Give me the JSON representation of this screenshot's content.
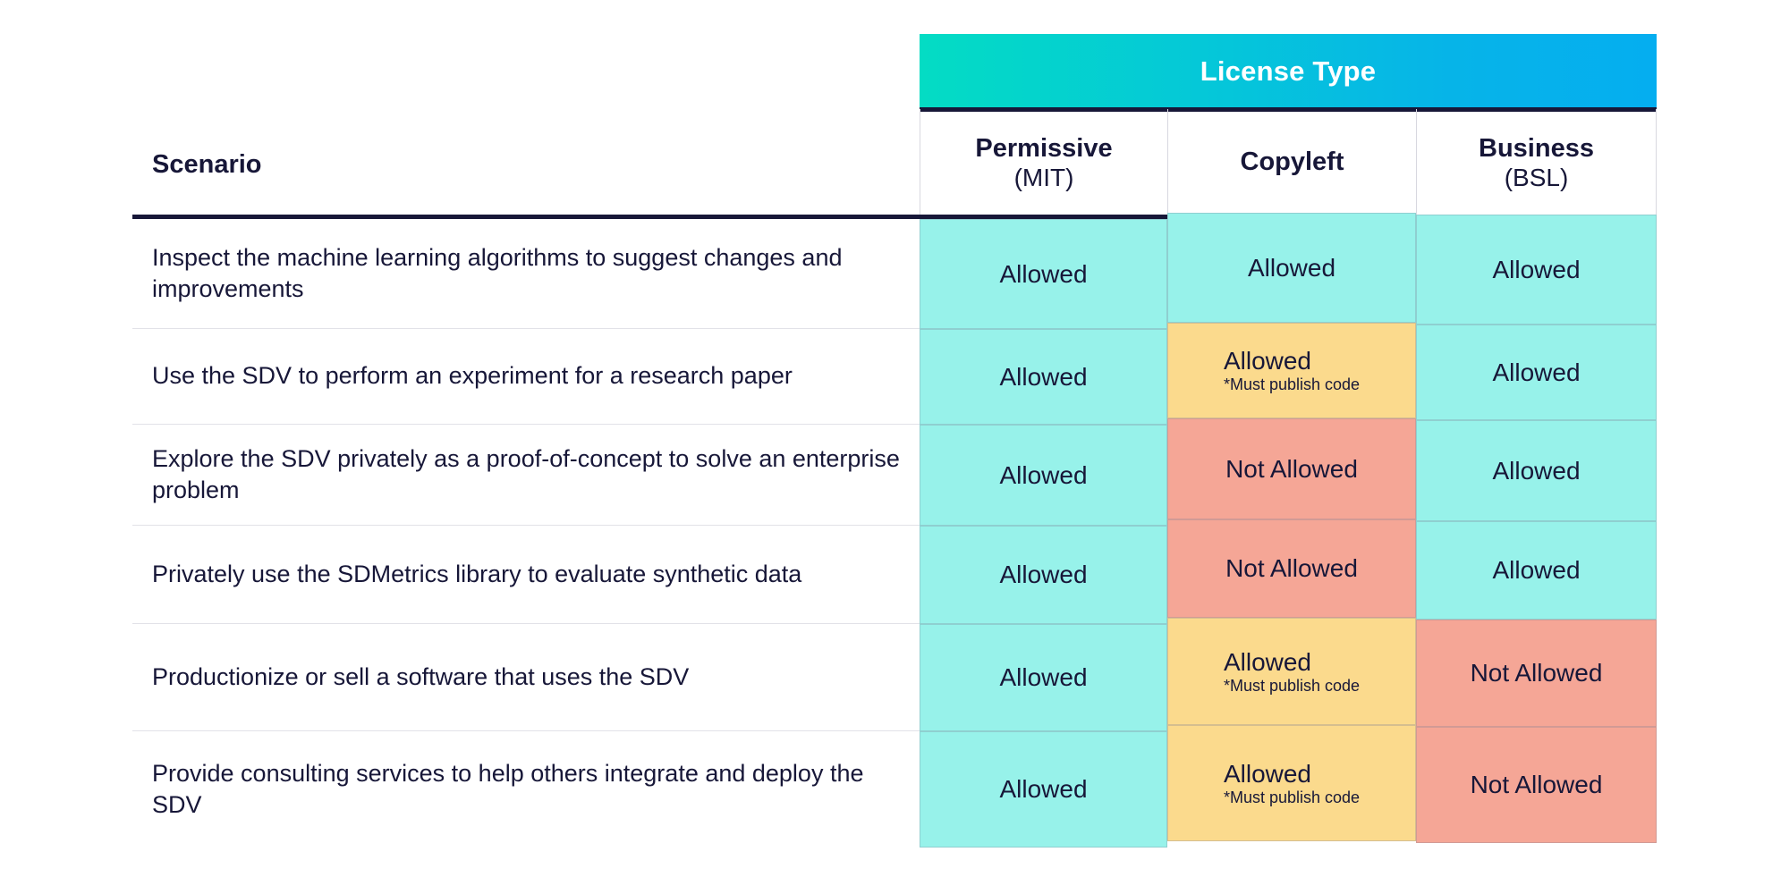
{
  "table": {
    "group_header": "License Type",
    "scenario_header": "Scenario",
    "columns": [
      {
        "name": "Permissive",
        "sub": "(MIT)"
      },
      {
        "name": "Copyleft",
        "sub": ""
      },
      {
        "name": "Business",
        "sub": "(BSL)"
      }
    ],
    "rows": [
      {
        "scenario": "Inspect the machine learning algorithms to suggest changes and improvements",
        "cells": [
          {
            "verdict": "Allowed",
            "note": "",
            "status": "allowed"
          },
          {
            "verdict": "Allowed",
            "note": "",
            "status": "allowed"
          },
          {
            "verdict": "Allowed",
            "note": "",
            "status": "allowed"
          }
        ]
      },
      {
        "scenario": "Use the SDV to perform an experiment for a research paper",
        "cells": [
          {
            "verdict": "Allowed",
            "note": "",
            "status": "allowed"
          },
          {
            "verdict": "Allowed",
            "note": "*Must publish code",
            "status": "conditional"
          },
          {
            "verdict": "Allowed",
            "note": "",
            "status": "allowed"
          }
        ]
      },
      {
        "scenario": "Explore the SDV privately as a proof-of-concept to solve an enterprise problem",
        "cells": [
          {
            "verdict": "Allowed",
            "note": "",
            "status": "allowed"
          },
          {
            "verdict": "Not Allowed",
            "note": "",
            "status": "denied"
          },
          {
            "verdict": "Allowed",
            "note": "",
            "status": "allowed"
          }
        ]
      },
      {
        "scenario": "Privately use the SDMetrics library to evaluate synthetic data",
        "cells": [
          {
            "verdict": "Allowed",
            "note": "",
            "status": "allowed"
          },
          {
            "verdict": "Not Allowed",
            "note": "",
            "status": "denied"
          },
          {
            "verdict": "Allowed",
            "note": "",
            "status": "allowed"
          }
        ]
      },
      {
        "scenario": "Productionize or sell a software that uses the SDV",
        "cells": [
          {
            "verdict": "Allowed",
            "note": "",
            "status": "allowed"
          },
          {
            "verdict": "Allowed",
            "note": "*Must publish code",
            "status": "conditional"
          },
          {
            "verdict": "Not Allowed",
            "note": "",
            "status": "denied"
          }
        ]
      },
      {
        "scenario": "Provide consulting services to help others integrate and deploy the SDV",
        "cells": [
          {
            "verdict": "Allowed",
            "note": "",
            "status": "allowed"
          },
          {
            "verdict": "Allowed",
            "note": "*Must publish code",
            "status": "conditional"
          },
          {
            "verdict": "Not Allowed",
            "note": "",
            "status": "denied"
          }
        ]
      }
    ]
  },
  "colors": {
    "allowed": "#97f2ea",
    "conditional": "#fbda8d",
    "denied": "#f5a696",
    "gradient_start": "#04dcc4",
    "gradient_end": "#05aef0",
    "rule": "#171738",
    "text": "#171738"
  }
}
